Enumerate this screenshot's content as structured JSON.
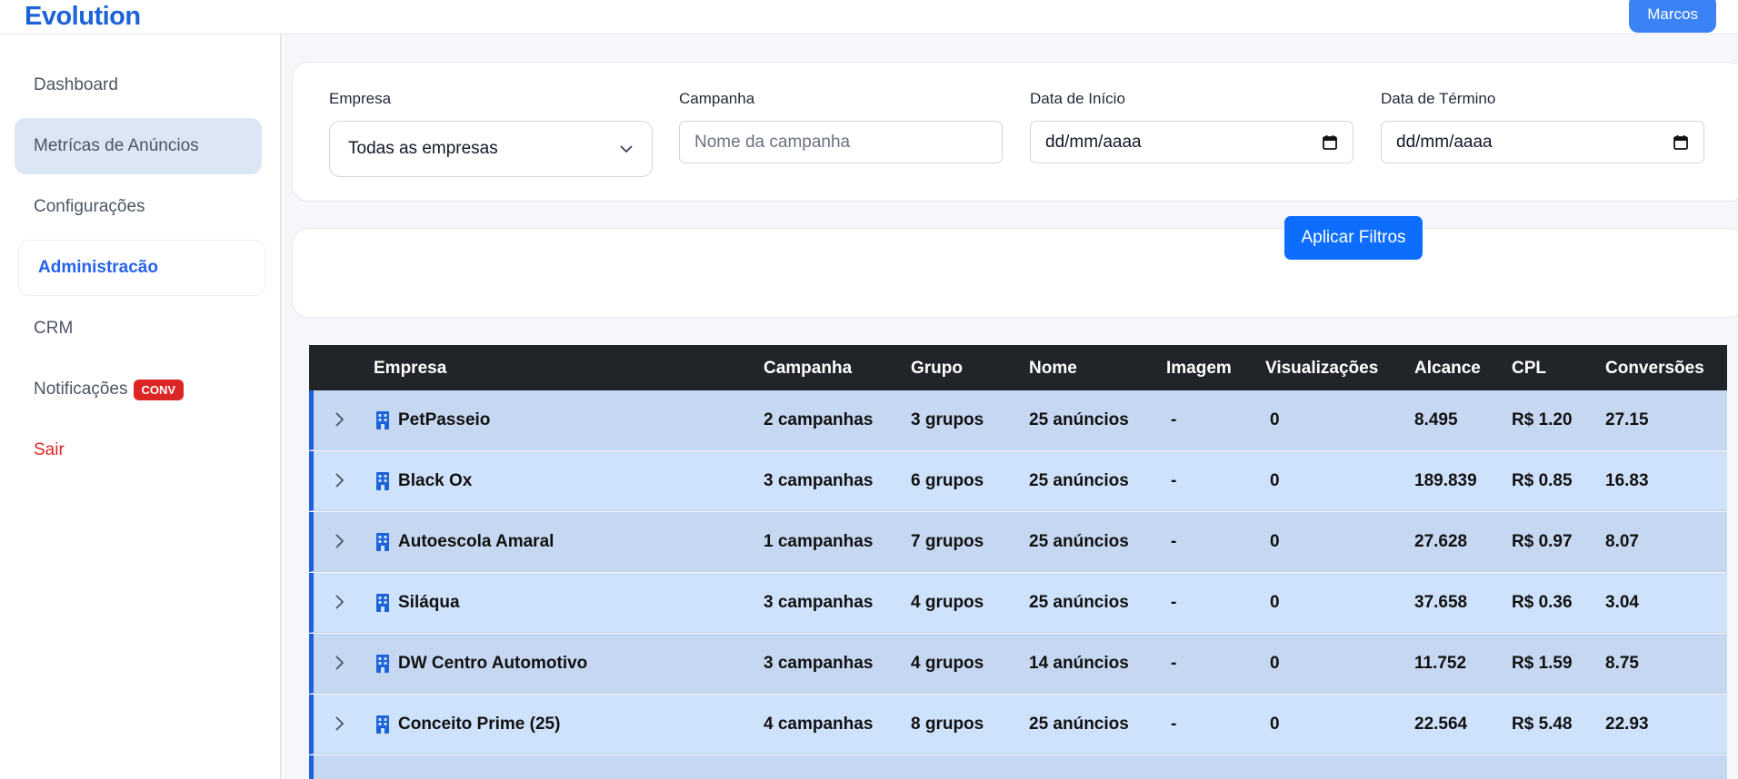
{
  "app": {
    "brand": "Evolution",
    "user_label": "Marcos"
  },
  "sidebar": {
    "items": [
      {
        "label": "Dashboard"
      },
      {
        "label": "Metrícas de Anúncios"
      },
      {
        "label": "Configurações"
      },
      {
        "label": "Administracão"
      },
      {
        "label": "CRM"
      },
      {
        "label": "Notificações",
        "badge": "CONV"
      },
      {
        "label": "Sair"
      }
    ]
  },
  "filters": {
    "empresa": {
      "label": "Empresa",
      "value": "Todas as empresas"
    },
    "campanha": {
      "label": "Campanha",
      "placeholder": "Nome da campanha"
    },
    "data_inicio": {
      "label": "Data de Início",
      "placeholder": "dd/mm/aaaa"
    },
    "data_termino": {
      "label": "Data de Término",
      "placeholder": "dd/mm/aaaa"
    },
    "apply_label": "Aplicar Filtros"
  },
  "table": {
    "headers": [
      "Empresa",
      "Campanha",
      "Grupo",
      "Nome",
      "Imagem",
      "Visualizações",
      "Alcance",
      "CPL",
      "Conversões"
    ],
    "rows": [
      [
        "PetPasseio",
        "2 campanhas",
        "3 grupos",
        "25 anúncios",
        "-",
        "0",
        "8.495",
        "R$ 1.20",
        "27.15"
      ],
      [
        "Black Ox",
        "3 campanhas",
        "6 grupos",
        "25 anúncios",
        "-",
        "0",
        "189.839",
        "R$ 0.85",
        "16.83"
      ],
      [
        "Autoescola Amaral",
        "1 campanhas",
        "7 grupos",
        "25 anúncios",
        "-",
        "0",
        "27.628",
        "R$ 0.97",
        "8.07"
      ],
      [
        "Siláqua",
        "3 campanhas",
        "4 grupos",
        "25 anúncios",
        "-",
        "0",
        "37.658",
        "R$ 0.36",
        "3.04"
      ],
      [
        "DW Centro Automotivo",
        "3 campanhas",
        "4 grupos",
        "14 anúncios",
        "-",
        "0",
        "11.752",
        "R$ 1.59",
        "8.75"
      ],
      [
        "Conceito Prime (25)",
        "4 campanhas",
        "8 grupos",
        "25 anúncios",
        "-",
        "0",
        "22.564",
        "R$ 5.48",
        "22.93"
      ]
    ]
  },
  "colors": {
    "accent": "#1d63d8",
    "button": "#0d6efd",
    "danger": "#dc2626",
    "header_bg": "#212529"
  }
}
